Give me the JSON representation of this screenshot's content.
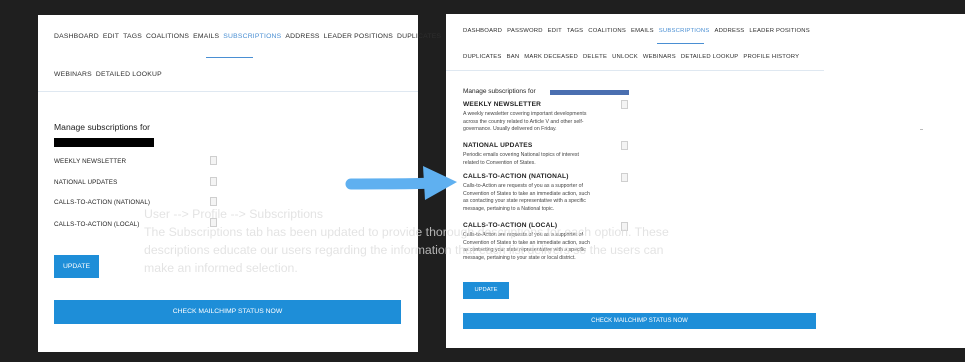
{
  "left": {
    "nav_row1": [
      "DASHBOARD",
      "EDIT",
      "TAGS",
      "COALITIONS",
      "EMAILS",
      "SUBSCRIPTIONS",
      "ADDRESS",
      "LEADER POSITIONS",
      "DUPLICATES"
    ],
    "nav_row2": [
      "WEBINARS",
      "DETAILED LOOKUP"
    ],
    "active_tab": "SUBSCRIPTIONS",
    "manage_title": "Manage subscriptions for",
    "rows": [
      "WEEKLY NEWSLETTER",
      "NATIONAL UPDATES",
      "CALLS-TO-ACTION (NATIONAL)",
      "CALLS-TO-ACTION (LOCAL)"
    ],
    "update_label": "UPDATE",
    "mailchimp_label": "CHECK MAILCHIMP STATUS NOW"
  },
  "right": {
    "nav_row1": [
      "DASHBOARD",
      "PASSWORD",
      "EDIT",
      "TAGS",
      "COALITIONS",
      "EMAILS",
      "SUBSCRIPTIONS",
      "ADDRESS",
      "LEADER POSITIONS"
    ],
    "nav_row2": [
      "DUPLICATES",
      "BAN",
      "MARK DECEASED",
      "DELETE",
      "UNLOCK",
      "WEBINARS",
      "DETAILED LOOKUP",
      "PROFILE HISTORY"
    ],
    "active_tab": "SUBSCRIPTIONS",
    "manage_title": "Manage subscriptions for",
    "items": [
      {
        "title": "WEEKLY NEWSLETTER",
        "desc": [
          "A weekly newsletter covering important developments",
          "across the country related to Article V and other self-",
          "governance. Usually delivered on Friday."
        ]
      },
      {
        "title": "NATIONAL UPDATES",
        "desc": [
          "Periodic emails covering National topics of interest",
          "related to Convention of States."
        ]
      },
      {
        "title": "CALLS-TO-ACTION (NATIONAL)",
        "desc": [
          "Calls-to-Action are requests of you as a supporter of",
          "Convention of States to take an immediate action, such",
          "as contacting your state representative with a specific",
          "message, pertaining to a National topic."
        ]
      },
      {
        "title": "CALLS-TO-ACTION (LOCAL)",
        "desc": [
          "Calls-to-Action are requests of you as a supporter of",
          "Convention of States to take an immediate action, such",
          "as contacting your state representative with a specific",
          "message, pertaining to your state or local district."
        ]
      }
    ],
    "update_label": "UPDATE",
    "mailchimp_label": "CHECK MAILCHIMP STATUS NOW"
  },
  "overlay": {
    "lines": [
      "User --> Profile --> Subscriptions",
      "The Subscriptions tab has been updated to provide thorough descriptions for each option.  These",
      "descriptions educate our users regarding the information that each list delivers so the users can",
      "make an informed selection."
    ]
  },
  "colors": {
    "accent": "#1e8ed8",
    "active_tab": "#4a8fd3",
    "arrow": "#5fb0f0"
  }
}
